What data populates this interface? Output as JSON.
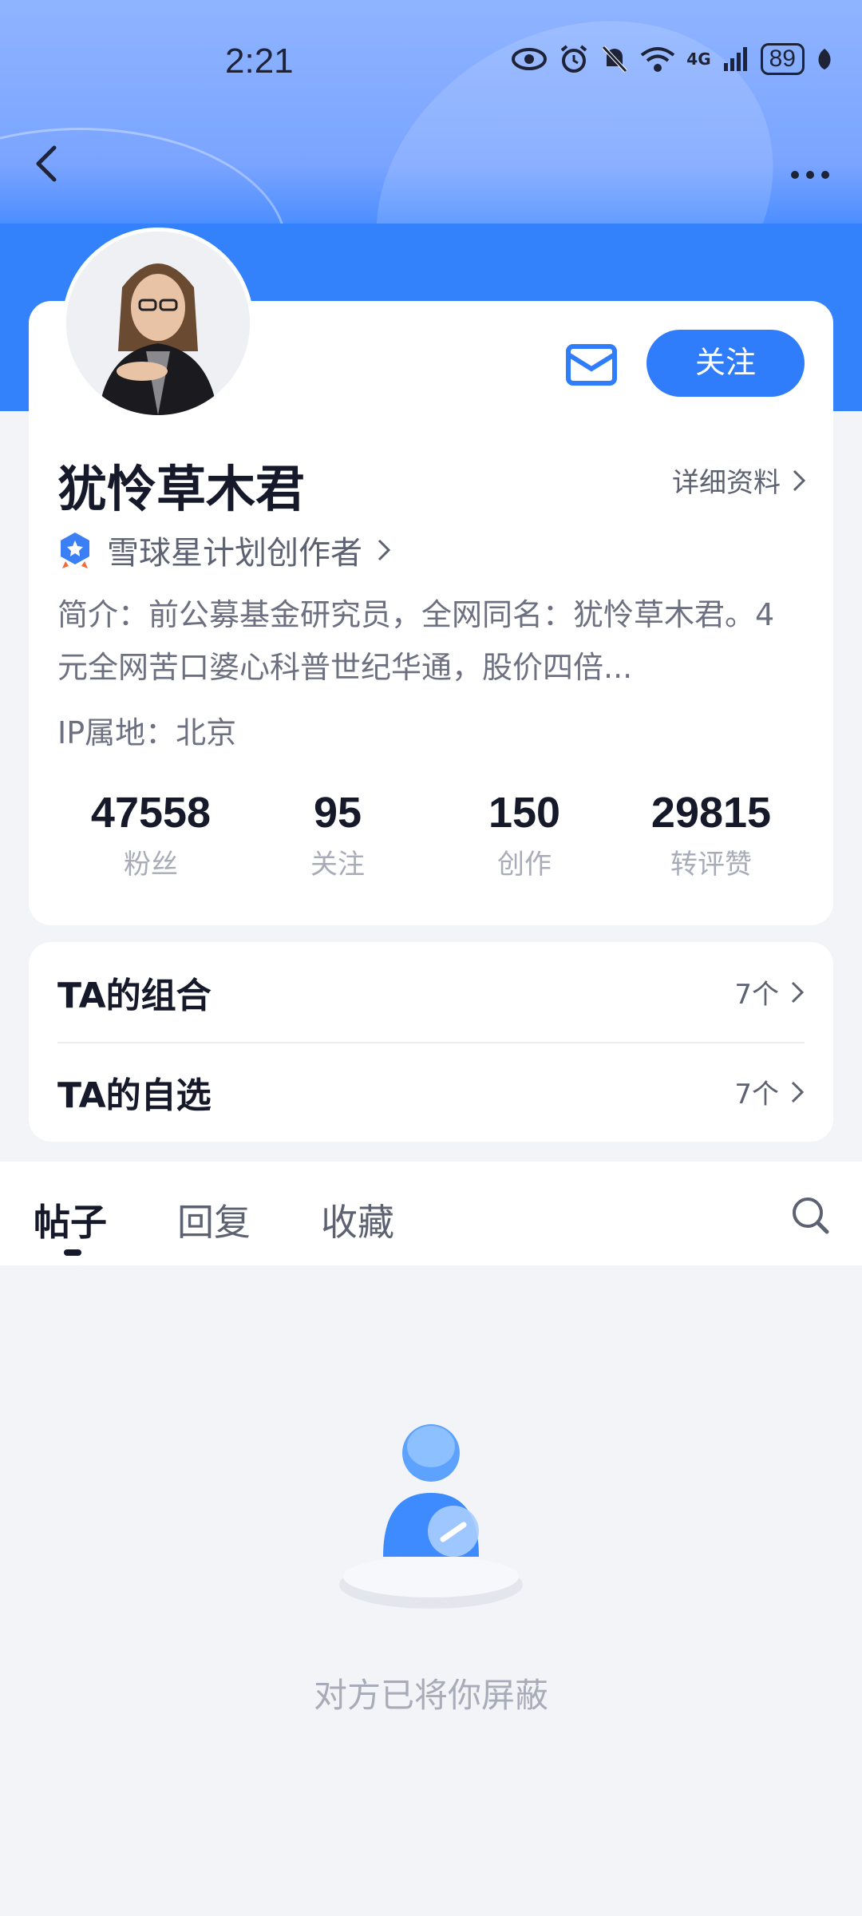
{
  "status_bar": {
    "time": "2:21",
    "battery": "89",
    "network": "4G"
  },
  "profile": {
    "follow_label": "关注",
    "username": "犹怜草木君",
    "detail_link": "详细资料",
    "creator_badge": "雪球星计划创作者",
    "bio": "简介：前公募基金研究员，全网同名：犹怜草木君。4元全网苦口婆心科普世纪华通，股价四倍...",
    "ip_location": "IP属地：北京",
    "stats": [
      {
        "value": "47558",
        "label": "粉丝"
      },
      {
        "value": "95",
        "label": "关注"
      },
      {
        "value": "150",
        "label": "创作"
      },
      {
        "value": "29815",
        "label": "转评赞"
      }
    ]
  },
  "lists": [
    {
      "label": "TA的组合",
      "count": "7个"
    },
    {
      "label": "TA的自选",
      "count": "7个"
    }
  ],
  "tabs": [
    {
      "label": "帖子",
      "active": true
    },
    {
      "label": "回复",
      "active": false
    },
    {
      "label": "收藏",
      "active": false
    }
  ],
  "empty_state": {
    "message": "对方已将你屏蔽"
  },
  "colors": {
    "accent": "#2f7dfb",
    "hero": "#3381fb"
  }
}
